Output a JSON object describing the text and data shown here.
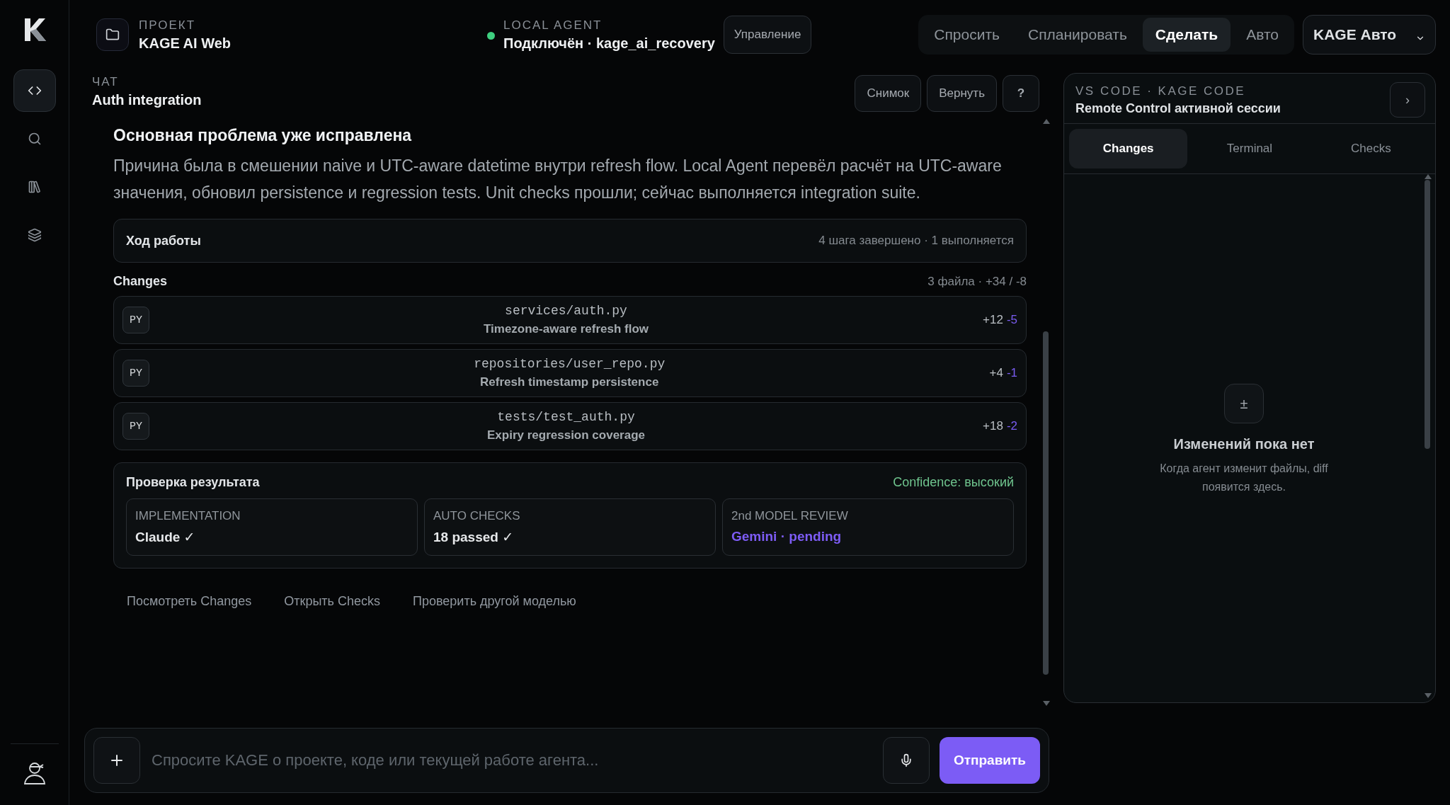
{
  "sidebar": {
    "items": [
      {
        "kind": "code",
        "selected": true
      },
      {
        "kind": "search",
        "selected": false
      },
      {
        "kind": "library",
        "selected": false
      },
      {
        "kind": "layers",
        "selected": false
      }
    ]
  },
  "header": {
    "project": {
      "label": "ПРОЕКТ",
      "name": "KAGE AI Web"
    },
    "agent": {
      "label": "LOCAL AGENT",
      "status": "Подключён · kage_ai_recovery",
      "connected": true
    },
    "manage_button": "Управление",
    "modes": [
      {
        "label": "Спросить",
        "selected": false
      },
      {
        "label": "Спланировать",
        "selected": false
      },
      {
        "label": "Сделать",
        "selected": true
      },
      {
        "label": "Авто",
        "selected": false
      }
    ],
    "model_select": "KAGE Авто"
  },
  "chat": {
    "label": "ЧАТ",
    "title": "Auth integration",
    "actions": [
      "Снимок",
      "Вернуть",
      "?"
    ],
    "message": {
      "heading": "Основная проблема уже исправлена",
      "body": "Причина была в смешении naive и UTC-aware datetime внутри refresh flow. Local Agent перевёл расчёт на UTC-aware значения, обновил persistence и regression tests. Unit checks прошли; сейчас выполняется integration suite."
    },
    "progress": {
      "title": "Ход работы",
      "summary": "4 шага завершено · 1 выполняется"
    },
    "changes": {
      "title": "Changes",
      "summary": "3 файла · +34 / -8",
      "files": [
        {
          "badge": "PY",
          "path": "services/auth.py",
          "description": "Timezone-aware refresh flow",
          "added": "+12",
          "removed": "-5"
        },
        {
          "badge": "PY",
          "path": "repositories/user_repo.py",
          "description": "Refresh timestamp persistence",
          "added": "+4",
          "removed": "-1"
        },
        {
          "badge": "PY",
          "path": "tests/test_auth.py",
          "description": "Expiry regression coverage",
          "added": "+18",
          "removed": "-2"
        }
      ]
    },
    "verification": {
      "title": "Проверка результата",
      "confidence": "Confidence: высокий",
      "cards": [
        {
          "label": "IMPLEMENTATION",
          "value": "Claude ✓",
          "pending": false
        },
        {
          "label": "AUTO CHECKS",
          "value": "18 passed ✓",
          "pending": false
        },
        {
          "label": "2nd MODEL REVIEW",
          "value": "Gemini · pending",
          "pending": true
        }
      ]
    },
    "links": [
      "Посмотреть Changes",
      "Открыть Checks",
      "Проверить другой моделью"
    ]
  },
  "panel": {
    "label": "VS CODE · KAGE CODE",
    "title": "Remote Control активной сессии",
    "expand": "›",
    "tabs": [
      {
        "label": "Changes",
        "selected": true
      },
      {
        "label": "Terminal",
        "selected": false
      },
      {
        "label": "Checks",
        "selected": false
      }
    ],
    "empty": {
      "icon": "±",
      "title": "Изменений пока нет",
      "text": "Когда агент изменит файлы, diff появится здесь."
    }
  },
  "composer": {
    "placeholder": "Спросите KAGE о проекте, коде или текущей работе агента...",
    "send": "Отправить"
  }
}
